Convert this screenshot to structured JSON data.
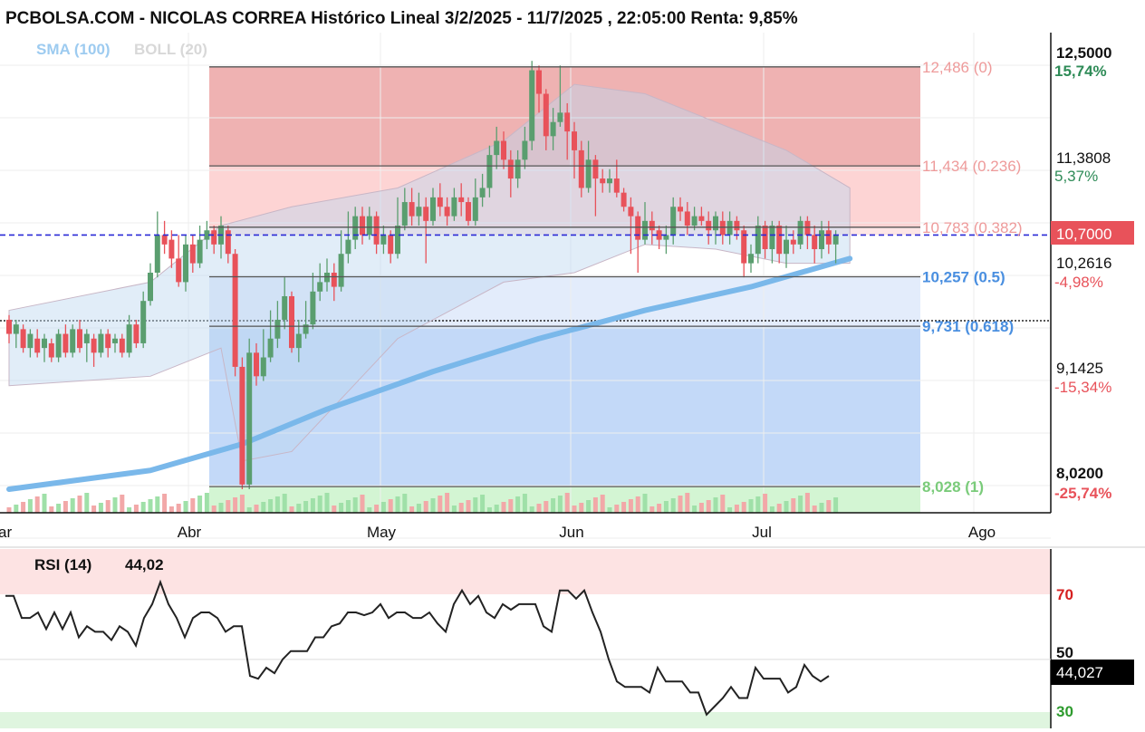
{
  "header": {
    "title": "PCBOLSA.COM - NICOLAS CORREA Histórico Lineal 3/2/2025 - 11/7/2025 , 22:05:00 Renta: 9,85%"
  },
  "legend": {
    "sma": "SMA (100)",
    "boll": "BOLL (20)"
  },
  "colors": {
    "up": "#5a9e6f",
    "down": "#e8525a",
    "sma": "#7ab8ea",
    "fib_red": "#ee9a9a",
    "fib_blue": "#4a8fe0",
    "fib_green": "#7acb7a",
    "rsi_line": "#222222",
    "last_badge": "#e8525a"
  },
  "price_axis": {
    "top_label": "12,5000",
    "top_pct": "15,74%",
    "mid_label": "11,3808",
    "mid_pct": "5,37%",
    "last_value": "10,7000",
    "label_3": "10,2616",
    "pct_3": "-4,98%",
    "label_4": "9,1425",
    "pct_4": "-15,34%",
    "bottom_label": "8,0200",
    "bottom_pct": "-25,74%"
  },
  "months": [
    "ar",
    "Abr",
    "May",
    "Jun",
    "Jul",
    "Ago"
  ],
  "fib_levels": [
    {
      "label": "12,486 (0)",
      "value": 12.486
    },
    {
      "label": "11,434 (0.236)",
      "value": 11.434
    },
    {
      "label": "10,783 (0.382)",
      "value": 10.783
    },
    {
      "label": "10,257 (0.5)",
      "value": 10.257
    },
    {
      "label": "9,731 (0.618)",
      "value": 9.731
    },
    {
      "label": "8,028 (1)",
      "value": 8.028
    }
  ],
  "rsi": {
    "label": "RSI (14)",
    "value": "44,02",
    "badge": "44,027",
    "levels": [
      "70",
      "50",
      "30"
    ]
  },
  "chart_data": {
    "type": "candlestick",
    "title": "PCBOLSA.COM - NICOLAS CORREA Histórico Lineal 3/2/2025 - 11/7/2025 , 22:05:00 Renta: 9,85%",
    "ylim": [
      7.75,
      12.85
    ],
    "last_price": 10.7,
    "candles": [
      [
        9.8,
        9.65,
        9.85,
        9.55
      ],
      [
        9.65,
        9.75,
        9.8,
        9.5
      ],
      [
        9.7,
        9.5,
        9.75,
        9.45
      ],
      [
        9.5,
        9.65,
        9.7,
        9.4
      ],
      [
        9.6,
        9.45,
        9.7,
        9.4
      ],
      [
        9.5,
        9.6,
        9.65,
        9.35
      ],
      [
        9.55,
        9.4,
        9.6,
        9.35
      ],
      [
        9.4,
        9.65,
        9.7,
        9.35
      ],
      [
        9.65,
        9.45,
        9.75,
        9.4
      ],
      [
        9.45,
        9.7,
        9.75,
        9.4
      ],
      [
        9.7,
        9.5,
        9.8,
        9.45
      ],
      [
        9.55,
        9.65,
        9.7,
        9.35
      ],
      [
        9.6,
        9.45,
        9.65,
        9.3
      ],
      [
        9.45,
        9.65,
        9.7,
        9.4
      ],
      [
        9.65,
        9.5,
        9.7,
        9.4
      ],
      [
        9.55,
        9.6,
        9.65,
        9.45
      ],
      [
        9.6,
        9.45,
        9.65,
        9.4
      ],
      [
        9.45,
        9.75,
        9.85,
        9.4
      ],
      [
        9.75,
        9.55,
        9.8,
        9.5
      ],
      [
        9.55,
        10.0,
        10.1,
        9.5
      ],
      [
        10.0,
        10.3,
        10.4,
        9.95
      ],
      [
        10.3,
        10.7,
        10.95,
        10.25
      ],
      [
        10.7,
        10.6,
        10.85,
        10.5
      ],
      [
        10.65,
        10.45,
        10.75,
        10.35
      ],
      [
        10.45,
        10.2,
        10.7,
        10.15
      ],
      [
        10.2,
        10.6,
        10.7,
        10.1
      ],
      [
        10.6,
        10.4,
        10.7,
        10.3
      ],
      [
        10.4,
        10.65,
        10.8,
        10.35
      ],
      [
        10.65,
        10.75,
        10.85,
        10.55
      ],
      [
        10.75,
        10.6,
        10.8,
        10.5
      ],
      [
        10.6,
        10.8,
        10.9,
        10.45
      ],
      [
        10.75,
        10.5,
        10.8,
        10.4
      ],
      [
        10.5,
        9.3,
        10.55,
        9.2
      ],
      [
        9.3,
        8.05,
        9.4,
        8.0
      ],
      [
        8.05,
        9.45,
        9.6,
        8.0
      ],
      [
        9.45,
        9.2,
        9.55,
        9.1
      ],
      [
        9.2,
        9.4,
        9.7,
        9.15
      ],
      [
        9.4,
        9.6,
        9.9,
        9.35
      ],
      [
        9.6,
        9.8,
        10.0,
        9.5
      ],
      [
        9.8,
        10.05,
        10.25,
        9.7
      ],
      [
        10.05,
        9.5,
        10.1,
        9.45
      ],
      [
        9.5,
        9.65,
        9.8,
        9.35
      ],
      [
        9.65,
        9.75,
        10.0,
        9.6
      ],
      [
        9.75,
        10.1,
        10.3,
        9.7
      ],
      [
        10.1,
        10.2,
        10.4,
        10.0
      ],
      [
        10.2,
        10.3,
        10.45,
        10.1
      ],
      [
        10.3,
        10.15,
        10.4,
        10.0
      ],
      [
        10.15,
        10.5,
        10.75,
        10.1
      ],
      [
        10.5,
        10.65,
        10.95,
        10.4
      ],
      [
        10.65,
        10.9,
        11.0,
        10.55
      ],
      [
        10.9,
        10.7,
        11.0,
        10.6
      ],
      [
        10.7,
        10.9,
        11.0,
        10.65
      ],
      [
        10.9,
        10.6,
        10.95,
        10.5
      ],
      [
        10.6,
        10.7,
        10.8,
        10.5
      ],
      [
        10.7,
        10.5,
        10.75,
        10.4
      ],
      [
        10.5,
        10.8,
        11.1,
        10.45
      ],
      [
        10.8,
        11.05,
        11.2,
        10.75
      ],
      [
        11.05,
        10.9,
        11.2,
        10.8
      ],
      [
        10.9,
        11.0,
        11.15,
        10.8
      ],
      [
        11.0,
        10.85,
        11.1,
        10.4
      ],
      [
        10.85,
        11.1,
        11.2,
        10.8
      ],
      [
        11.1,
        11.0,
        11.25,
        10.9
      ],
      [
        11.0,
        10.9,
        11.1,
        10.8
      ],
      [
        10.9,
        11.1,
        11.2,
        10.85
      ],
      [
        11.1,
        11.05,
        11.25,
        10.9
      ],
      [
        11.05,
        10.85,
        11.1,
        10.8
      ],
      [
        10.85,
        11.1,
        11.3,
        10.8
      ],
      [
        11.1,
        11.2,
        11.35,
        11.0
      ],
      [
        11.2,
        11.55,
        11.65,
        11.1
      ],
      [
        11.55,
        11.7,
        11.85,
        11.4
      ],
      [
        11.7,
        11.5,
        11.8,
        11.4
      ],
      [
        11.5,
        11.3,
        11.6,
        11.1
      ],
      [
        11.3,
        11.5,
        11.6,
        11.2
      ],
      [
        11.5,
        11.7,
        11.85,
        11.4
      ],
      [
        11.7,
        12.45,
        12.55,
        11.6
      ],
      [
        12.45,
        12.2,
        12.5,
        12.0
      ],
      [
        12.2,
        11.75,
        12.25,
        11.6
      ],
      [
        11.75,
        11.9,
        12.05,
        11.6
      ],
      [
        11.9,
        12.0,
        12.5,
        11.85
      ],
      [
        12.0,
        11.8,
        12.1,
        11.5
      ],
      [
        11.8,
        11.6,
        11.9,
        11.3
      ],
      [
        11.6,
        11.2,
        11.7,
        11.1
      ],
      [
        11.2,
        11.5,
        11.7,
        11.15
      ],
      [
        11.5,
        11.3,
        11.55,
        10.9
      ],
      [
        11.3,
        11.25,
        11.4,
        11.15
      ],
      [
        11.25,
        11.3,
        11.4,
        11.15
      ],
      [
        11.3,
        11.15,
        11.5,
        11.1
      ],
      [
        11.15,
        11.0,
        11.2,
        10.95
      ],
      [
        11.0,
        10.9,
        11.1,
        10.5
      ],
      [
        10.9,
        10.65,
        10.95,
        10.3
      ],
      [
        10.65,
        10.85,
        11.05,
        10.6
      ],
      [
        10.85,
        10.75,
        10.95,
        10.6
      ],
      [
        10.75,
        10.65,
        10.8,
        10.55
      ],
      [
        10.65,
        10.7,
        10.8,
        10.5
      ],
      [
        10.7,
        11.0,
        11.1,
        10.6
      ],
      [
        11.0,
        10.95,
        11.1,
        10.85
      ],
      [
        10.95,
        10.8,
        11.05,
        10.7
      ],
      [
        10.8,
        10.9,
        11.0,
        10.75
      ],
      [
        10.9,
        10.85,
        11.0,
        10.8
      ],
      [
        10.85,
        10.75,
        10.95,
        10.6
      ],
      [
        10.75,
        10.9,
        10.95,
        10.6
      ],
      [
        10.85,
        10.7,
        10.95,
        10.6
      ],
      [
        10.7,
        10.85,
        10.95,
        10.6
      ],
      [
        10.85,
        10.75,
        10.9,
        10.65
      ],
      [
        10.75,
        10.4,
        10.8,
        10.25
      ],
      [
        10.4,
        10.5,
        10.6,
        10.3
      ],
      [
        10.5,
        10.8,
        10.9,
        10.4
      ],
      [
        10.8,
        10.55,
        10.85,
        10.45
      ],
      [
        10.55,
        10.8,
        10.85,
        10.4
      ],
      [
        10.8,
        10.5,
        10.85,
        10.4
      ],
      [
        10.5,
        10.65,
        10.8,
        10.35
      ],
      [
        10.65,
        10.6,
        10.75,
        10.5
      ],
      [
        10.6,
        10.85,
        10.9,
        10.55
      ],
      [
        10.85,
        10.7,
        10.9,
        10.55
      ],
      [
        10.7,
        10.55,
        10.8,
        10.4
      ],
      [
        10.55,
        10.75,
        10.85,
        10.45
      ],
      [
        10.75,
        10.6,
        10.85,
        10.5
      ],
      [
        10.6,
        10.7,
        10.75,
        10.4
      ]
    ],
    "volumes": [
      2,
      1,
      1,
      1,
      1,
      1,
      2,
      3,
      1,
      1,
      1,
      1,
      1,
      1,
      1,
      1,
      1,
      1,
      1,
      1,
      1,
      1,
      1,
      1,
      1,
      1,
      1,
      1,
      1,
      1,
      1,
      1,
      1,
      1,
      1,
      1,
      1,
      1,
      1,
      1,
      1,
      1,
      1,
      1,
      1,
      1,
      1,
      1,
      1,
      1,
      1,
      1,
      1,
      1,
      1,
      1,
      1,
      1,
      1,
      1,
      1,
      1,
      1,
      1,
      1,
      1,
      1,
      1,
      1,
      1,
      1,
      1,
      1,
      1,
      1,
      1,
      1,
      1,
      1,
      1,
      1,
      1,
      1,
      1,
      1,
      1,
      1,
      1,
      1,
      1,
      1,
      1,
      1,
      1,
      1,
      1,
      1,
      1,
      1,
      1,
      1,
      1,
      1,
      1,
      1,
      1,
      1,
      1,
      1,
      1,
      1,
      1,
      1,
      1,
      1,
      1,
      1,
      1,
      1
    ],
    "sma100": [
      [
        0,
        8.0
      ],
      [
        20,
        8.2
      ],
      [
        33,
        8.48
      ],
      [
        45,
        8.85
      ],
      [
        60,
        9.25
      ],
      [
        75,
        9.6
      ],
      [
        90,
        9.9
      ],
      [
        105,
        10.15
      ],
      [
        119,
        10.45
      ]
    ],
    "boll_upper": [
      [
        0,
        9.9
      ],
      [
        20,
        10.2
      ],
      [
        30,
        10.8
      ],
      [
        40,
        11.0
      ],
      [
        55,
        11.2
      ],
      [
        70,
        11.7
      ],
      [
        80,
        12.3
      ],
      [
        90,
        12.2
      ],
      [
        100,
        11.9
      ],
      [
        110,
        11.6
      ],
      [
        119,
        11.2
      ]
    ],
    "boll_lower": [
      [
        0,
        9.1
      ],
      [
        20,
        9.2
      ],
      [
        30,
        9.5
      ],
      [
        33,
        8.3
      ],
      [
        40,
        8.4
      ],
      [
        55,
        9.6
      ],
      [
        70,
        10.2
      ],
      [
        80,
        10.3
      ],
      [
        90,
        10.6
      ],
      [
        100,
        10.55
      ],
      [
        110,
        10.4
      ],
      [
        119,
        10.4
      ]
    ],
    "rsi_series": [
      73,
      73,
      65,
      65,
      67,
      61,
      67,
      61,
      67,
      58,
      62,
      60,
      60,
      57,
      62,
      60,
      55,
      65,
      70,
      78,
      70,
      65,
      58,
      65,
      67,
      67,
      65,
      60,
      62,
      62,
      44,
      43,
      47,
      45,
      50,
      53,
      53,
      53,
      58,
      58,
      62,
      63,
      67,
      67,
      66,
      67,
      70,
      65,
      67,
      67,
      65,
      65,
      67,
      63,
      60,
      70,
      75,
      70,
      73,
      67,
      65,
      70,
      68,
      70,
      70,
      70,
      62,
      60,
      75,
      75,
      72,
      75,
      67,
      60,
      50,
      42,
      40,
      40,
      40,
      38,
      47,
      42,
      42,
      42,
      38,
      38,
      30,
      33,
      36,
      40,
      36,
      36,
      47,
      43,
      43,
      43,
      38,
      40,
      48,
      44,
      42,
      44
    ],
    "rsi_ylim": [
      25,
      90
    ],
    "rsi_levels": [
      70,
      50,
      30
    ]
  }
}
